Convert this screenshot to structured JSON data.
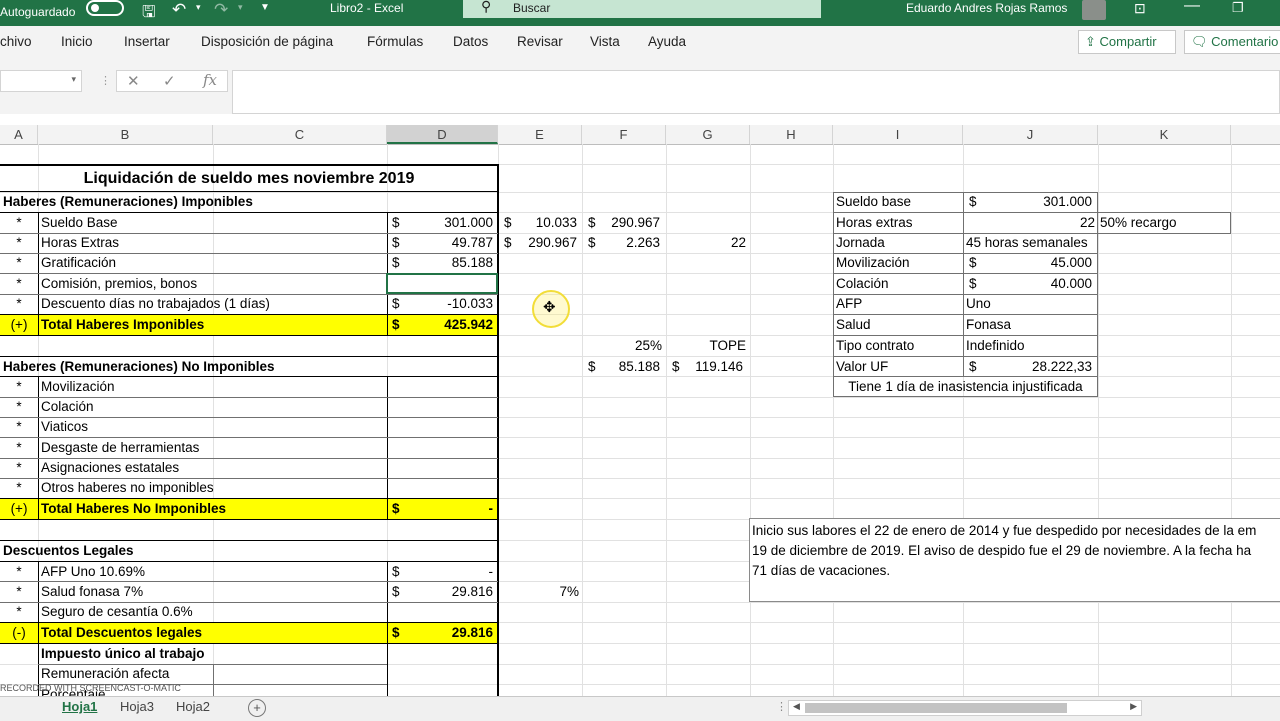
{
  "titlebar": {
    "autosave": "Autoguardado",
    "doc_title": "Libro2  -  Excel",
    "search_placeholder": "Buscar",
    "user": "Eduardo Andres Rojas Ramos"
  },
  "ribbon": {
    "tabs": [
      "chivo",
      "Inicio",
      "Insertar",
      "Disposición de página",
      "Fórmulas",
      "Datos",
      "Revisar",
      "Vista",
      "Ayuda"
    ],
    "share": "Compartir",
    "comments": "Comentario"
  },
  "formula_bar": {
    "fx": "fx"
  },
  "columns": [
    "A",
    "B",
    "C",
    "D",
    "E",
    "F",
    "G",
    "H",
    "I",
    "J",
    "K"
  ],
  "sheet": {
    "title": "Liquidación de sueldo mes noviembre 2019",
    "sec1": "Haberes (Remuneraciones) Imponibles",
    "rows1": [
      {
        "mark": "*",
        "label": "Sueldo Base",
        "cur": "$",
        "val": "301.000"
      },
      {
        "mark": "*",
        "label": "Horas Extras",
        "cur": "$",
        "val": "49.787"
      },
      {
        "mark": "*",
        "label": "Gratificación",
        "cur": "$",
        "val": "85.188"
      },
      {
        "mark": "*",
        "label": "Comisión, premios, bonos",
        "cur": "",
        "val": ""
      },
      {
        "mark": "*",
        "label": "Descuento días no trabajados (1 días)",
        "cur": "$",
        "val": "-10.033"
      }
    ],
    "total1": {
      "mark": "(+)",
      "label": "Total Haberes Imponibles",
      "cur": "$",
      "val": "425.942"
    },
    "sec2": "Haberes (Remuneraciones) No Imponibles",
    "rows2": [
      {
        "mark": "*",
        "label": "Movilización"
      },
      {
        "mark": "*",
        "label": "Colación"
      },
      {
        "mark": "*",
        "label": "Viaticos"
      },
      {
        "mark": "*",
        "label": "Desgaste de herramientas"
      },
      {
        "mark": "*",
        "label": "Asignaciones estatales"
      },
      {
        "mark": "*",
        "label": "Otros haberes no imponibles"
      }
    ],
    "total2": {
      "mark": "(+)",
      "label": "Total Haberes No Imponibles",
      "cur": "$",
      "val": "-"
    },
    "sec3": "Descuentos Legales",
    "rows3": [
      {
        "mark": "*",
        "label": "AFP Uno 10.69%",
        "cur": "$",
        "val": "-"
      },
      {
        "mark": "*",
        "label": "Salud fonasa 7%",
        "cur": "$",
        "val": "29.816"
      },
      {
        "mark": "*",
        "label": "Seguro de cesantía 0.6%",
        "cur": "",
        "val": ""
      }
    ],
    "total3": {
      "mark": "(-)",
      "label": "Total Descuentos legales",
      "cur": "$",
      "val": "29.816"
    },
    "sec4": "Impuesto único al trabajo",
    "row4": "Remuneración afecta",
    "row5": "Porcentaje",
    "aux": {
      "e1_cur": "$",
      "e1": "10.033",
      "f1_cur": "$",
      "f1": "290.967",
      "e2_cur": "$",
      "e2": "290.967",
      "f2_cur": "$",
      "f2": "2.263",
      "g2": "22",
      "pct": "25%",
      "tope": "TOPE",
      "f3_cur": "$",
      "f3": "85.188",
      "g3_cur": "$",
      "g3": "119.146",
      "e4": "7%"
    },
    "info": [
      {
        "k": "Sueldo base",
        "cur": "$",
        "v": "301.000"
      },
      {
        "k": "Horas extras",
        "cur": "",
        "v": "22",
        "extra": "50% recargo"
      },
      {
        "k": "Jornada",
        "cur": "",
        "v": "45 horas semanales"
      },
      {
        "k": "Movilización",
        "cur": "$",
        "v": "45.000"
      },
      {
        "k": "Colación",
        "cur": "$",
        "v": "40.000"
      },
      {
        "k": "AFP",
        "cur": "",
        "v": "Uno"
      },
      {
        "k": "Salud",
        "cur": "",
        "v": "Fonasa"
      },
      {
        "k": "Tipo contrato",
        "cur": "",
        "v": "Indefinido"
      },
      {
        "k": "Valor UF",
        "cur": "$",
        "v": "28.222,33"
      }
    ],
    "info_note": "Tiene 1 día de inasistencia injustificada",
    "note_lines": [
      "Inicio sus labores el 22 de enero de 2014 y fue despedido por necesidades de la em",
      "19 de diciembre de 2019. El aviso de despido fue el 29 de noviembre. A la fecha ha",
      "71 días de vacaciones."
    ]
  },
  "sheet_tabs": [
    "Hoja1",
    "Hoja3",
    "Hoja2"
  ],
  "watermark": "RECORDED WITH SCREENCAST-O-MATIC"
}
